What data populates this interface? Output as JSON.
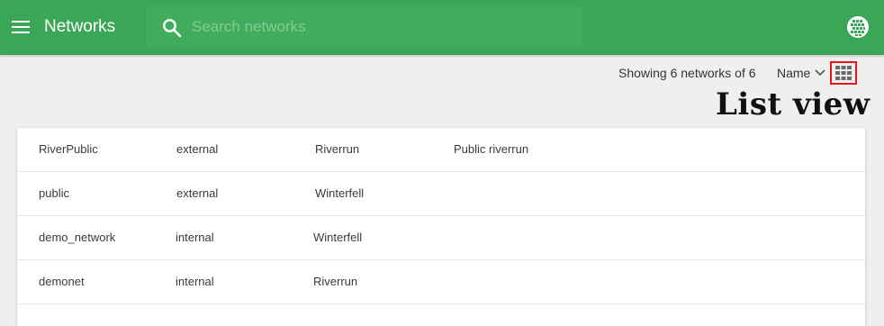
{
  "header": {
    "title": "Networks",
    "search_placeholder": "Search networks",
    "search_value": ""
  },
  "icons": {
    "menu": "hamburger-menu-icon",
    "search": "search-icon",
    "user": "globe-avatar-icon",
    "sort": "chevron-down-icon",
    "view": "grid-view-icon"
  },
  "toolbar": {
    "showing_text": "Showing 6 networks of 6",
    "sort_label": "Name"
  },
  "annotation": {
    "label": "List view"
  },
  "networks": [
    {
      "name": "RiverPublic",
      "type": "external",
      "cloud": "Riverrun",
      "description": "Public riverrun"
    },
    {
      "name": "public",
      "type": "external",
      "cloud": "Winterfell",
      "description": ""
    },
    {
      "name": "demo_network",
      "type": "internal",
      "cloud": "Winterfell",
      "description": ""
    },
    {
      "name": "demonet",
      "type": "internal",
      "cloud": "Riverrun",
      "description": ""
    }
  ],
  "colors": {
    "header_bg": "#3aa757",
    "page_bg": "#efefef",
    "highlight_border": "#e8141a"
  }
}
